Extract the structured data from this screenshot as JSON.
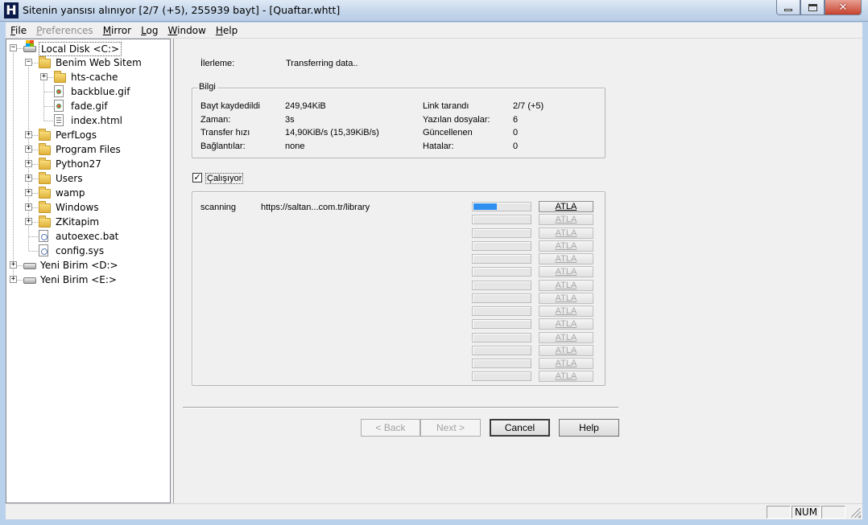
{
  "window": {
    "title": "Sitenin yansısı alınıyor [2/7 (+5), 255939 bayt] - [Quaftar.whtt]",
    "icon_letter": "H",
    "close_glyph": "✕"
  },
  "menu": [
    {
      "label": "File",
      "accel": "F",
      "rest": "ile",
      "enabled": true
    },
    {
      "label": "Preferences",
      "accel": "P",
      "rest": "references",
      "enabled": false
    },
    {
      "label": "Mirror",
      "accel": "M",
      "rest": "irror",
      "enabled": true
    },
    {
      "label": "Log",
      "accel": "L",
      "rest": "og",
      "enabled": true
    },
    {
      "label": "Window",
      "accel": "W",
      "rest": "indow",
      "enabled": true
    },
    {
      "label": "Help",
      "accel": "H",
      "rest": "elp",
      "enabled": true
    }
  ],
  "tree": {
    "items": [
      {
        "label": "Local Disk <C:>",
        "icon": "drive-system-icon",
        "expanded": true,
        "selected": true
      },
      {
        "label": "Benim Web Sitem",
        "icon": "folder-icon",
        "expanded": true
      },
      {
        "label": "hts-cache",
        "icon": "folder-icon",
        "expanded": false
      },
      {
        "label": "backblue.gif",
        "icon": "gif-file-icon"
      },
      {
        "label": "fade.gif",
        "icon": "gif-file-icon"
      },
      {
        "label": "index.html",
        "icon": "html-file-icon"
      },
      {
        "label": "PerfLogs",
        "icon": "folder-icon",
        "expanded": false
      },
      {
        "label": "Program Files",
        "icon": "folder-icon",
        "expanded": false
      },
      {
        "label": "Python27",
        "icon": "folder-icon",
        "expanded": false
      },
      {
        "label": "Users",
        "icon": "folder-icon",
        "expanded": false
      },
      {
        "label": "wamp",
        "icon": "folder-icon",
        "expanded": false
      },
      {
        "label": "Windows",
        "icon": "folder-icon",
        "expanded": false
      },
      {
        "label": "ZKitapim",
        "icon": "folder-icon",
        "expanded": false
      },
      {
        "label": "autoexec.bat",
        "icon": "config-file-icon"
      },
      {
        "label": "config.sys",
        "icon": "config-file-icon"
      },
      {
        "label": "Yeni Birim <D:>",
        "icon": "drive-icon",
        "expanded": false
      },
      {
        "label": "Yeni Birim <E:>",
        "icon": "drive-icon",
        "expanded": false
      }
    ]
  },
  "progress": {
    "label": "İlerleme:",
    "value": "Transferring data.."
  },
  "info": {
    "title": "Bilgi",
    "left": [
      {
        "label": "Bayt kaydedildi",
        "value": "249,94KiB"
      },
      {
        "label": "Zaman:",
        "value": "3s"
      },
      {
        "label": "Transfer hızı",
        "value": "14,90KiB/s (15,39KiB/s)"
      },
      {
        "label": "Bağlantılar:",
        "value": "none"
      }
    ],
    "right": [
      {
        "label": "Link tarandı",
        "value": "2/7 (+5)"
      },
      {
        "label": "Yazılan dosyalar:",
        "value": "6"
      },
      {
        "label": "Güncellenen",
        "value": "0"
      },
      {
        "label": "Hatalar:",
        "value": "0"
      }
    ]
  },
  "running": {
    "label": "Çalışıyor",
    "checked": true,
    "check_glyph": "✓"
  },
  "transfers": {
    "skip_label": "ATLA",
    "rows": [
      {
        "status": "scanning",
        "url": "https://saltan...com.tr/library",
        "progress": 0.42,
        "active": true
      },
      {
        "status": "",
        "url": "",
        "progress": 0,
        "active": false
      },
      {
        "status": "",
        "url": "",
        "progress": 0,
        "active": false
      },
      {
        "status": "",
        "url": "",
        "progress": 0,
        "active": false
      },
      {
        "status": "",
        "url": "",
        "progress": 0,
        "active": false
      },
      {
        "status": "",
        "url": "",
        "progress": 0,
        "active": false
      },
      {
        "status": "",
        "url": "",
        "progress": 0,
        "active": false
      },
      {
        "status": "",
        "url": "",
        "progress": 0,
        "active": false
      },
      {
        "status": "",
        "url": "",
        "progress": 0,
        "active": false
      },
      {
        "status": "",
        "url": "",
        "progress": 0,
        "active": false
      },
      {
        "status": "",
        "url": "",
        "progress": 0,
        "active": false
      },
      {
        "status": "",
        "url": "",
        "progress": 0,
        "active": false
      },
      {
        "status": "",
        "url": "",
        "progress": 0,
        "active": false
      },
      {
        "status": "",
        "url": "",
        "progress": 0,
        "active": false
      }
    ]
  },
  "buttons": {
    "back": "< Back",
    "next": "Next >",
    "cancel": "Cancel",
    "help": "Help"
  },
  "statusbar": {
    "num": "NUM"
  },
  "colors": {
    "progress_fill": "#2e8ff0",
    "window_frame": "#b9d1ea"
  }
}
